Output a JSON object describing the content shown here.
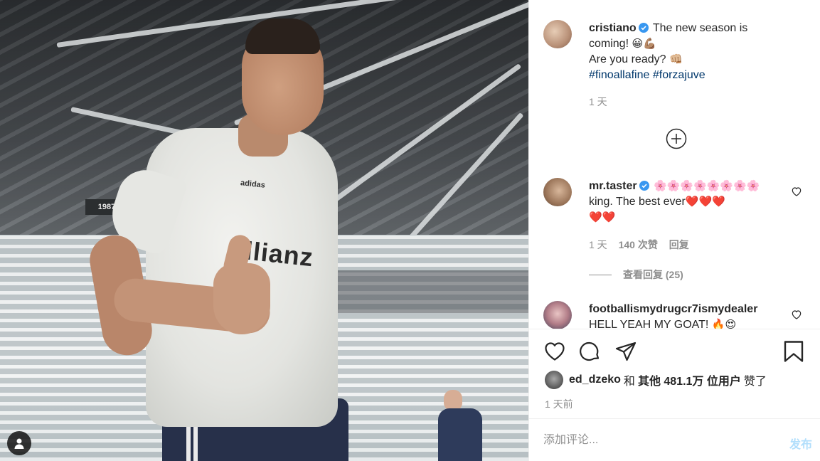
{
  "photo": {
    "sponsor_text": "Allianz",
    "brand_text": "adidas",
    "stadium_board": "1987"
  },
  "post": {
    "caption": {
      "username": "cristiano",
      "text_line1": "The new season is coming!",
      "emoji1": "😀💪🏽",
      "text_line2": "Are you ready?",
      "emoji2": "👊🏼",
      "hashtag1": "#finoallafine",
      "hashtag2": "#forzajuve",
      "time": "1 天"
    },
    "comments": [
      {
        "username": "mr.taster",
        "emoji_prefix": "🌸🌸🌸🌸🌸🌸🌸🌸",
        "text": "king. The best ever",
        "emoji_suffix1": "❤️❤️❤️",
        "emoji_suffix2": "❤️❤️",
        "time": "1 天",
        "likes": "140 次赞",
        "reply_label": "回复",
        "view_replies": "查看回复 (25)"
      },
      {
        "username": "footballismydrugcr7ismydealer",
        "text": "HELL YEAH MY GOAT!",
        "emoji": "🔥😍"
      }
    ],
    "likes": {
      "user": "ed_dzeko",
      "and": "和",
      "others_label": "其他 481.1万 位用户",
      "suffix": "赞了"
    },
    "posted_ago": "1 天前",
    "add_comment_placeholder": "添加评论...",
    "post_button": "发布"
  },
  "icons": {
    "like": "heart-icon",
    "comment": "comment-icon",
    "share": "share-icon",
    "save": "bookmark-icon",
    "load_more": "plus-circle-icon",
    "tag": "user-tag-icon",
    "verified": "verified-badge-icon"
  },
  "colors": {
    "verified": "#3897f0",
    "hashtag": "#00376b",
    "muted": "#8e8e8e",
    "post_disabled": "#b2dffc"
  }
}
